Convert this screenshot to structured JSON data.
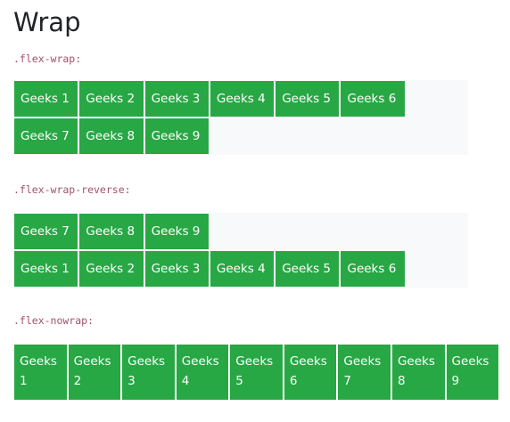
{
  "title": "Wrap",
  "sections": [
    {
      "label": ".flex-wrap:",
      "items": [
        "Geeks 1",
        "Geeks 2",
        "Geeks 3",
        "Geeks 4",
        "Geeks 5",
        "Geeks 6",
        "Geeks 7",
        "Geeks 8",
        "Geeks 9"
      ]
    },
    {
      "label": ".flex-wrap-reverse:",
      "items": [
        "Geeks 1",
        "Geeks 2",
        "Geeks 3",
        "Geeks 4",
        "Geeks 5",
        "Geeks 6",
        "Geeks 7",
        "Geeks 8",
        "Geeks 9"
      ]
    },
    {
      "label": ".flex-nowrap:",
      "items": [
        "Geeks 1",
        "Geeks 2",
        "Geeks 3",
        "Geeks 4",
        "Geeks 5",
        "Geeks 6",
        "Geeks 7",
        "Geeks 8",
        "Geeks 9"
      ]
    }
  ],
  "colors": {
    "item_bg": "#28a745",
    "container_bg": "#f8f9fa",
    "code_text": "#a0526d"
  }
}
